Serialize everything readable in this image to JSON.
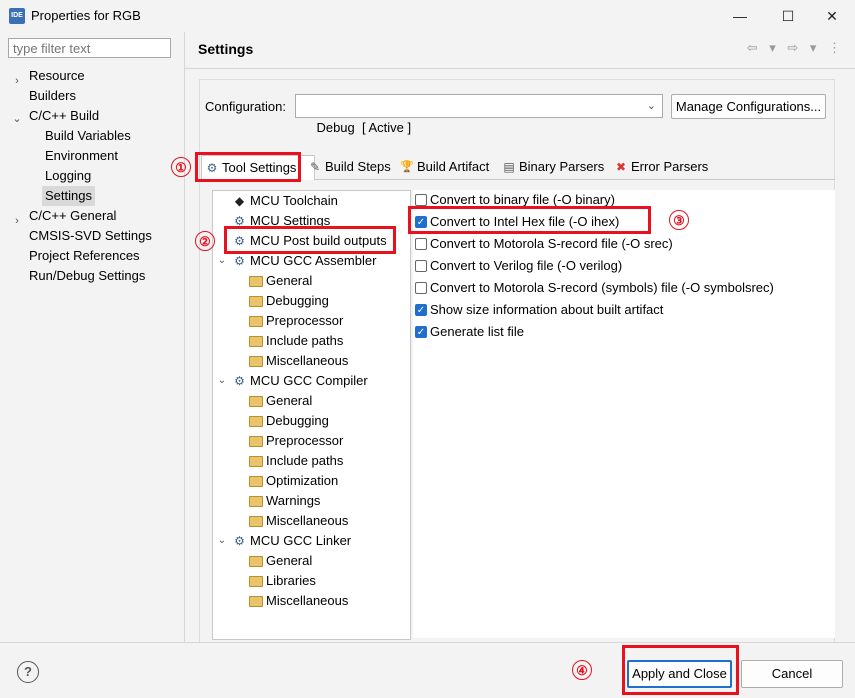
{
  "window": {
    "app_icon_text": "IDE",
    "title": "Properties for RGB",
    "minimize_glyph": "—",
    "maximize_glyph": "☐",
    "close_glyph": "✕"
  },
  "sidebar": {
    "filter_placeholder": "type filter text",
    "items": [
      {
        "label": "Resource",
        "chevron": "›"
      },
      {
        "label": "Builders"
      },
      {
        "label": "C/C++ Build",
        "chevron": "⌄"
      },
      {
        "label": "Build Variables"
      },
      {
        "label": "Environment"
      },
      {
        "label": "Logging"
      },
      {
        "label": "Settings"
      },
      {
        "label": "C/C++ General",
        "chevron": "›"
      },
      {
        "label": "CMSIS-SVD Settings"
      },
      {
        "label": "Project References"
      },
      {
        "label": "Run/Debug Settings"
      }
    ]
  },
  "main": {
    "title": "Settings",
    "nav_arrows": "⇦ ▾ ⇨ ▾ ⋮",
    "configuration_label": "Configuration:",
    "configuration_value": "Debug  [ Active ]",
    "configuration_dropdown": "⌄",
    "manage_button": "Manage Configurations...",
    "tabs": [
      {
        "label": "Tool Settings",
        "icon": "⚙"
      },
      {
        "label": "Build Steps",
        "icon": "✎"
      },
      {
        "label": "Build Artifact",
        "icon": "🏆"
      },
      {
        "label": "Binary Parsers",
        "icon": "▤"
      },
      {
        "label": "Error Parsers",
        "icon": "✖"
      }
    ],
    "tree": [
      {
        "label": "MCU Toolchain",
        "icon": "chip"
      },
      {
        "label": "MCU Settings",
        "icon": "gear"
      },
      {
        "label": "MCU Post build outputs",
        "icon": "gear"
      },
      {
        "label": "MCU GCC Assembler",
        "icon": "gear",
        "chevron": "⌄"
      },
      {
        "label": "General",
        "icon": "folder"
      },
      {
        "label": "Debugging",
        "icon": "folder"
      },
      {
        "label": "Preprocessor",
        "icon": "folder"
      },
      {
        "label": "Include paths",
        "icon": "folder"
      },
      {
        "label": "Miscellaneous",
        "icon": "folder"
      },
      {
        "label": "MCU GCC Compiler",
        "icon": "gear",
        "chevron": "⌄"
      },
      {
        "label": "General",
        "icon": "folder"
      },
      {
        "label": "Debugging",
        "icon": "folder"
      },
      {
        "label": "Preprocessor",
        "icon": "folder"
      },
      {
        "label": "Include paths",
        "icon": "folder"
      },
      {
        "label": "Optimization",
        "icon": "folder"
      },
      {
        "label": "Warnings",
        "icon": "folder"
      },
      {
        "label": "Miscellaneous",
        "icon": "folder"
      },
      {
        "label": "MCU GCC Linker",
        "icon": "gear",
        "chevron": "⌄"
      },
      {
        "label": "General",
        "icon": "folder"
      },
      {
        "label": "Libraries",
        "icon": "folder"
      },
      {
        "label": "Miscellaneous",
        "icon": "folder"
      }
    ],
    "options": [
      {
        "label": "Convert to binary file (-O binary)",
        "checked": false
      },
      {
        "label": "Convert to Intel Hex file (-O ihex)",
        "checked": true
      },
      {
        "label": "Convert to Motorola S-record file (-O srec)",
        "checked": false
      },
      {
        "label": "Convert to Verilog file (-O verilog)",
        "checked": false
      },
      {
        "label": "Convert to Motorola S-record (symbols) file (-O symbolsrec)",
        "checked": false
      },
      {
        "label": "Show size information about built artifact",
        "checked": true
      },
      {
        "label": "Generate list file",
        "checked": true
      }
    ],
    "check_glyph": "✓"
  },
  "footer": {
    "help_glyph": "?",
    "apply_close_button": "Apply and Close",
    "cancel_button": "Cancel"
  },
  "annotations": {
    "marker_1": "①",
    "marker_2": "②",
    "marker_3": "③",
    "marker_4": "④",
    "highlight_color": "#e8121f"
  }
}
